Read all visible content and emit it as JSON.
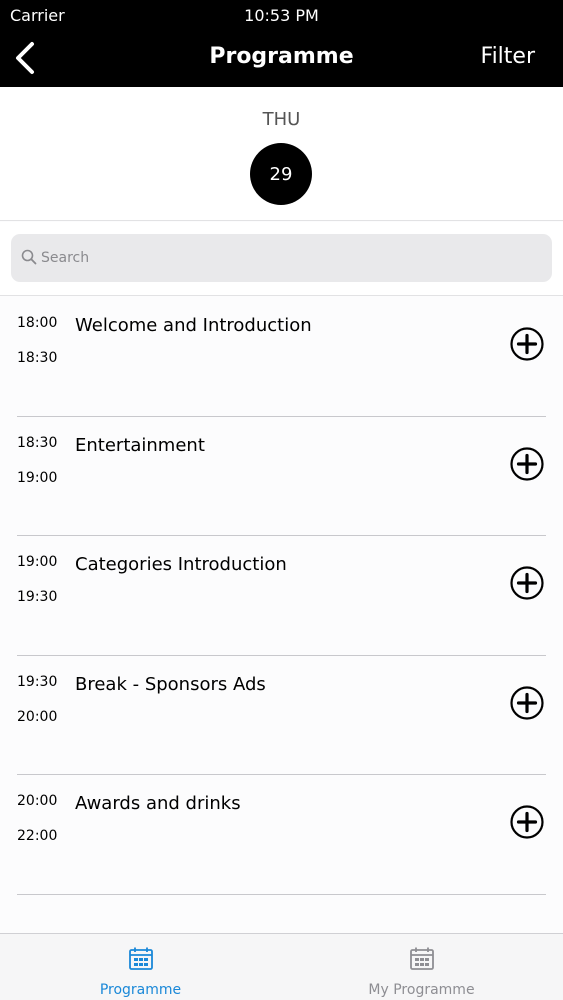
{
  "status_bar": {
    "carrier": "Carrier",
    "time": "10:53 PM"
  },
  "nav": {
    "title": "Programme",
    "filter_label": "Filter",
    "back_icon": "chevron-left-icon"
  },
  "date": {
    "weekday": "THU",
    "day": "29"
  },
  "search": {
    "placeholder": "Search",
    "value": ""
  },
  "items": [
    {
      "start": "18:00",
      "end": "18:30",
      "title": "Welcome and Introduction"
    },
    {
      "start": "18:30",
      "end": "19:00",
      "title": "Entertainment"
    },
    {
      "start": "19:00",
      "end": "19:30",
      "title": "Categories Introduction"
    },
    {
      "start": "19:30",
      "end": "20:00",
      "title": "Break - Sponsors Ads"
    },
    {
      "start": "20:00",
      "end": "22:00",
      "title": "Awards and drinks"
    }
  ],
  "tabs": [
    {
      "label": "Programme",
      "icon": "calendar-icon",
      "active": true
    },
    {
      "label": "My Programme",
      "icon": "calendar-icon",
      "active": false
    }
  ],
  "colors": {
    "accent": "#1a88d8",
    "inactive": "#8e8e93",
    "header_bg": "#000000"
  }
}
